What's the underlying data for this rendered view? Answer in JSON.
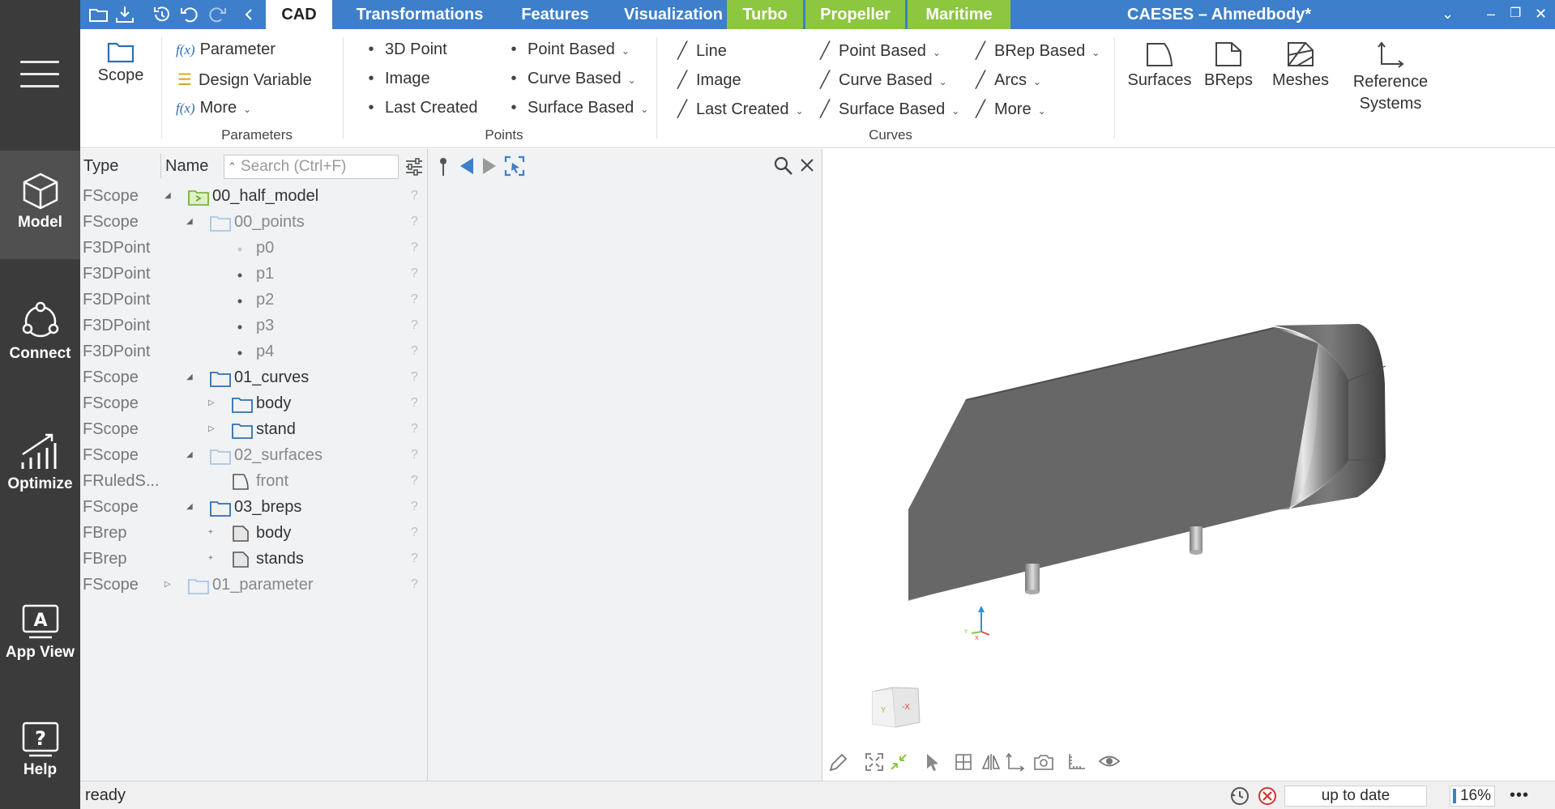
{
  "window": {
    "title": "CAESES – Ahmedbody*"
  },
  "quick_access": [
    "open-folder-icon",
    "save-icon",
    "history-icon",
    "undo-icon",
    "redo-icon",
    "chevron-left-icon"
  ],
  "tabs": [
    {
      "label": "CAD",
      "active": true
    },
    {
      "label": "Transformations"
    },
    {
      "label": "Features"
    },
    {
      "label": "Visualization"
    },
    {
      "label": "Turbo",
      "green": true
    },
    {
      "label": "Propeller",
      "green": true
    },
    {
      "label": "Maritime",
      "green": true
    }
  ],
  "sidebar": {
    "items": [
      {
        "label": "Model",
        "active": true
      },
      {
        "label": "Connect"
      },
      {
        "label": "Optimize"
      },
      {
        "label": "App View"
      },
      {
        "label": "Help"
      }
    ]
  },
  "ribbon": {
    "scope": "Scope",
    "parameters": {
      "items": [
        "Parameter",
        "Design Variable",
        "More"
      ],
      "group": "Parameters"
    },
    "points": {
      "col1": [
        "3D Point",
        "Image",
        "Last Created"
      ],
      "col2": [
        "Point Based",
        "Curve Based",
        "Surface Based"
      ],
      "group": "Points"
    },
    "curves": {
      "col1": [
        "Line",
        "Image",
        "Last Created"
      ],
      "col2": [
        "Point Based",
        "Curve Based",
        "Surface Based"
      ],
      "col3": [
        "BRep Based",
        "Arcs",
        "More"
      ],
      "group": "Curves"
    },
    "big_buttons": [
      "Surfaces",
      "BReps",
      "Meshes",
      "Reference Systems"
    ]
  },
  "tree": {
    "headers": {
      "type": "Type",
      "name": "Name"
    },
    "search_placeholder": "Search (Ctrl+F)",
    "rows": [
      {
        "type": "FScope",
        "name": "00_half_model",
        "level": 0,
        "expander": "open",
        "icon": "folder-green"
      },
      {
        "type": "FScope",
        "name": "00_points",
        "level": 1,
        "expander": "open",
        "icon": "folder-light",
        "dim": true
      },
      {
        "type": "F3DPoint",
        "name": "p0",
        "level": 2,
        "icon": "dot-light",
        "dim": true
      },
      {
        "type": "F3DPoint",
        "name": "p1",
        "level": 2,
        "icon": "dot",
        "dim": true
      },
      {
        "type": "F3DPoint",
        "name": "p2",
        "level": 2,
        "icon": "dot",
        "dim": true
      },
      {
        "type": "F3DPoint",
        "name": "p3",
        "level": 2,
        "icon": "dot",
        "dim": true
      },
      {
        "type": "F3DPoint",
        "name": "p4",
        "level": 2,
        "icon": "dot",
        "dim": true
      },
      {
        "type": "FScope",
        "name": "01_curves",
        "level": 1,
        "expander": "open",
        "icon": "folder"
      },
      {
        "type": "FScope",
        "name": "body",
        "level": 2,
        "expander": "closed",
        "icon": "folder"
      },
      {
        "type": "FScope",
        "name": "stand",
        "level": 2,
        "expander": "closed",
        "icon": "folder"
      },
      {
        "type": "FScope",
        "name": "02_surfaces",
        "level": 1,
        "expander": "open",
        "icon": "folder-light",
        "dim": true
      },
      {
        "type": "FRuledS...",
        "name": "front",
        "level": 2,
        "icon": "surface",
        "dim": true
      },
      {
        "type": "FScope",
        "name": "03_breps",
        "level": 1,
        "expander": "open",
        "icon": "folder"
      },
      {
        "type": "FBrep",
        "name": "body",
        "level": 2,
        "expander": "plus",
        "icon": "brep"
      },
      {
        "type": "FBrep",
        "name": "stands",
        "level": 2,
        "expander": "plus",
        "icon": "brep"
      },
      {
        "type": "FScope",
        "name": "01_parameter",
        "level": 0,
        "expander": "closed",
        "icon": "folder-light",
        "dim": true
      }
    ],
    "row_flag": "?"
  },
  "viewport": {
    "orient_cube": {
      "left": "Y",
      "right": "-X"
    },
    "tools": [
      "pencil-icon",
      "fit-all-icon",
      "collapse-icon",
      "pointer-icon",
      "grid-view-icon",
      "mirror-icon",
      "axis-icon",
      "camera-icon",
      "ruler-icon",
      "eye-icon"
    ]
  },
  "status": {
    "left": "ready",
    "state": "up to date",
    "zoom": "16%",
    "more": "•••"
  },
  "colors": {
    "topbar": "#3d7fcb",
    "green_tab": "#8dc63f",
    "sidebar": "#3b3b3b",
    "panel": "#f0f2f3"
  }
}
